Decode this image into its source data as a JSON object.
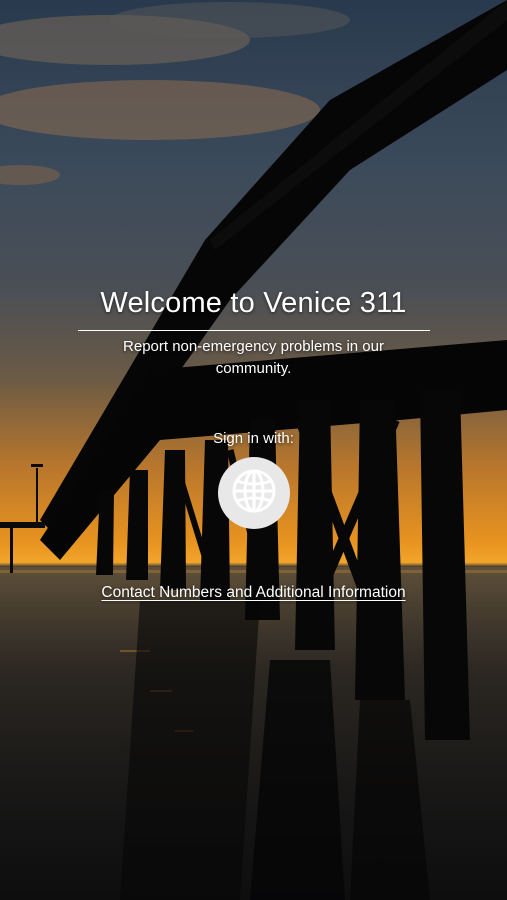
{
  "welcome": {
    "title": "Welcome to Venice 311",
    "subtitle": "Report non-emergency problems in our community.",
    "signin_label": "Sign in with:",
    "provider_icon": "globe-icon",
    "contact_link": "Contact Numbers and Additional Information"
  },
  "colors": {
    "text": "#ffffff",
    "button_bg": "#e8e8e8",
    "icon": "#ffffff"
  }
}
